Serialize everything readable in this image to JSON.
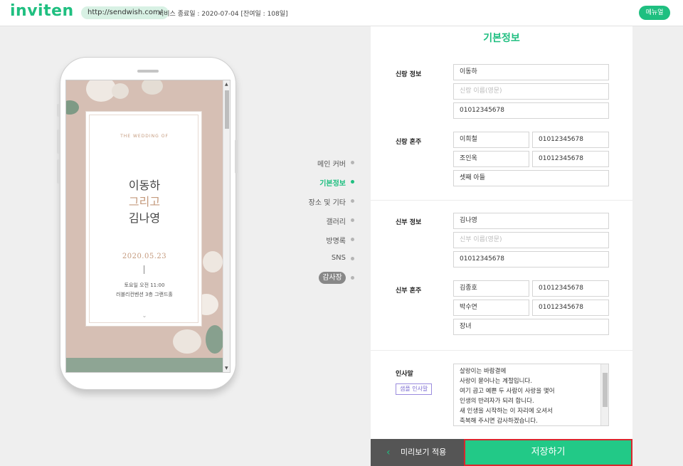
{
  "header": {
    "logo": "inviten",
    "url": "http://sendwish.com/",
    "service_info": "서비스 종료일 : 2020-07-04 [잔여일 : 108일]",
    "menu_button": "메뉴얼"
  },
  "preview": {
    "wedding_of": "THE WEDDING OF",
    "groom": "이동하",
    "and": "그리고",
    "bride": "김나영",
    "date": "2020.05.23",
    "time": "토요일 오전 11:00",
    "place": "러블리컨벤션 3층 그랜드홀"
  },
  "nav": {
    "items": [
      {
        "label": "메인 커버"
      },
      {
        "label": "기본정보"
      },
      {
        "label": "장소 및 기타"
      },
      {
        "label": "갤러리"
      },
      {
        "label": "방명록"
      },
      {
        "label": "SNS"
      },
      {
        "label": "감사장"
      }
    ],
    "active_index": 1
  },
  "form": {
    "title": "기본정보",
    "groom_info": {
      "label": "신랑 정보",
      "name": "이동하",
      "name_en_placeholder": "신랑 이름(영문)",
      "phone": "01012345678"
    },
    "groom_parents": {
      "label": "신랑 혼주",
      "father": "이희철",
      "father_phone": "01012345678",
      "mother": "조인옥",
      "mother_phone": "01012345678",
      "relation": "셋째 아들"
    },
    "bride_info": {
      "label": "신부 정보",
      "name": "김나영",
      "name_en_placeholder": "신부 이름(영문)",
      "phone": "01012345678"
    },
    "bride_parents": {
      "label": "신부 혼주",
      "father": "김종호",
      "father_phone": "01012345678",
      "mother": "박수연",
      "mother_phone": "01012345678",
      "relation": "장녀"
    },
    "greeting": {
      "label": "인사말",
      "sample_button": "샘플 인사말",
      "lines": [
        "살랑이는 바람결에",
        "사랑이 묻어나는 계절입니다.",
        "여기 곱고 예쁜 두 사람이 사랑을 맺어",
        "인생의 반려자가 되려 합니다.",
        "새 인생을 시작하는 이 자리에 오셔서",
        "축복해 주시면 감사하겠습니다."
      ]
    }
  },
  "footer": {
    "preview_button": "미리보기 적용",
    "save_button": "저장하기"
  },
  "colors": {
    "brand_green": "#1fbf80",
    "save_border": "#d8272d",
    "preview_bg": "#d6bfb4"
  }
}
